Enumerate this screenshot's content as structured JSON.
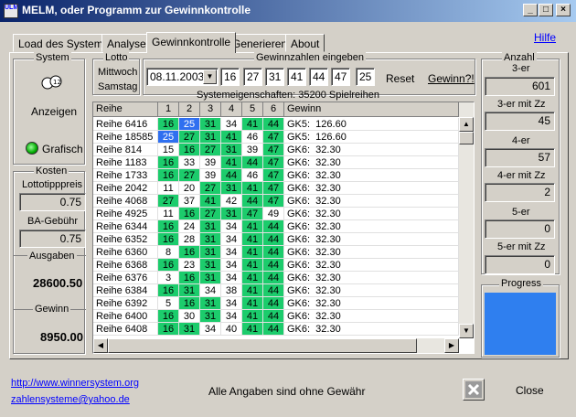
{
  "window": {
    "icon_text": "ULM",
    "title": "MELM, oder Programm zur Gewinnkontrolle",
    "minimize": "_",
    "maximize": "□",
    "close": "×"
  },
  "tabs": [
    "Load des Systems",
    "Analyse",
    "Gewinnkontrolle",
    "Generieren",
    "About"
  ],
  "active_tab": "Gewinnkontrolle",
  "help_link": "Hilfe",
  "system_group": {
    "title": "System",
    "icon": "lotto-balls-icon",
    "anzeigen": "Anzeigen",
    "grafisch": "Grafisch"
  },
  "kosten_group": {
    "title": "Kosten",
    "lottotipppreis_label": "Lottotipppreis",
    "lottotipppreis_value": "0.75",
    "ba_gebuehr_label": "BA-Gebühr",
    "ba_gebuehr_value": "0.75",
    "ausgaben_label": "Ausgaben",
    "ausgaben_value": "28600.50",
    "gewinn_label": "Gewinn",
    "gewinn_value": "8950.00"
  },
  "lotto_group": {
    "title": "Lotto",
    "mittwoch": "Mittwoch",
    "samstag": "Samstag"
  },
  "gewinnzahlen_group": {
    "title": "Gewinnzahlen eingeben",
    "date": "08.11.2003",
    "numbers": [
      "16",
      "27",
      "31",
      "41",
      "44",
      "47"
    ],
    "zusatzzahl": "25",
    "reset": "Reset",
    "gewinn_button": "Gewinn?!"
  },
  "systemeigenschaften": "Systemeigenschaften: 35200 Spielreihen",
  "grid": {
    "headers": [
      "Reihe",
      "1",
      "2",
      "3",
      "4",
      "5",
      "6",
      "Gewinn"
    ],
    "rows": [
      {
        "reihe": "Reihe 6416",
        "nums": [
          "16",
          "25",
          "31",
          "34",
          "41",
          "44"
        ],
        "hl": [
          "g",
          "b",
          "g",
          "",
          "g",
          "g"
        ],
        "gewinn": "GK5:  126.60"
      },
      {
        "reihe": "Reihe 18585",
        "nums": [
          "25",
          "27",
          "31",
          "41",
          "46",
          "47"
        ],
        "hl": [
          "b",
          "g",
          "g",
          "g",
          "",
          "g"
        ],
        "gewinn": "GK5:  126.60"
      },
      {
        "reihe": "Reihe 814",
        "nums": [
          "15",
          "16",
          "27",
          "31",
          "39",
          "47"
        ],
        "hl": [
          "",
          "g",
          "g",
          "g",
          "",
          "g"
        ],
        "gewinn": "GK6:  32.30"
      },
      {
        "reihe": "Reihe 1183",
        "nums": [
          "16",
          "33",
          "39",
          "41",
          "44",
          "47"
        ],
        "hl": [
          "g",
          "",
          "",
          "g",
          "g",
          "g"
        ],
        "gewinn": "GK6:  32.30"
      },
      {
        "reihe": "Reihe 1733",
        "nums": [
          "16",
          "27",
          "39",
          "44",
          "46",
          "47"
        ],
        "hl": [
          "g",
          "g",
          "",
          "g",
          "",
          "g"
        ],
        "gewinn": "GK6:  32.30"
      },
      {
        "reihe": "Reihe 2042",
        "nums": [
          "11",
          "20",
          "27",
          "31",
          "41",
          "47"
        ],
        "hl": [
          "",
          "",
          "g",
          "g",
          "g",
          "g"
        ],
        "gewinn": "GK6:  32.30"
      },
      {
        "reihe": "Reihe 4068",
        "nums": [
          "27",
          "37",
          "41",
          "42",
          "44",
          "47"
        ],
        "hl": [
          "g",
          "",
          "g",
          "",
          "g",
          "g"
        ],
        "gewinn": "GK6:  32.30"
      },
      {
        "reihe": "Reihe 4925",
        "nums": [
          "11",
          "16",
          "27",
          "31",
          "47",
          "49"
        ],
        "hl": [
          "",
          "g",
          "g",
          "g",
          "g",
          ""
        ],
        "gewinn": "GK6:  32.30"
      },
      {
        "reihe": "Reihe 6344",
        "nums": [
          "16",
          "24",
          "31",
          "34",
          "41",
          "44"
        ],
        "hl": [
          "g",
          "",
          "g",
          "",
          "g",
          "g"
        ],
        "gewinn": "GK6:  32.30"
      },
      {
        "reihe": "Reihe 6352",
        "nums": [
          "16",
          "28",
          "31",
          "34",
          "41",
          "44"
        ],
        "hl": [
          "g",
          "",
          "g",
          "",
          "g",
          "g"
        ],
        "gewinn": "GK6:  32.30"
      },
      {
        "reihe": "Reihe 6360",
        "nums": [
          "8",
          "16",
          "31",
          "34",
          "41",
          "44"
        ],
        "hl": [
          "",
          "g",
          "g",
          "",
          "g",
          "g"
        ],
        "gewinn": "GK6:  32.30"
      },
      {
        "reihe": "Reihe 6368",
        "nums": [
          "16",
          "23",
          "31",
          "34",
          "41",
          "44"
        ],
        "hl": [
          "g",
          "",
          "g",
          "",
          "g",
          "g"
        ],
        "gewinn": "GK6:  32.30"
      },
      {
        "reihe": "Reihe 6376",
        "nums": [
          "3",
          "16",
          "31",
          "34",
          "41",
          "44"
        ],
        "hl": [
          "",
          "g",
          "g",
          "",
          "g",
          "g"
        ],
        "gewinn": "GK6:  32.30"
      },
      {
        "reihe": "Reihe 6384",
        "nums": [
          "16",
          "31",
          "34",
          "38",
          "41",
          "44"
        ],
        "hl": [
          "g",
          "g",
          "",
          "",
          "g",
          "g"
        ],
        "gewinn": "GK6:  32.30"
      },
      {
        "reihe": "Reihe 6392",
        "nums": [
          "5",
          "16",
          "31",
          "34",
          "41",
          "44"
        ],
        "hl": [
          "",
          "g",
          "g",
          "",
          "g",
          "g"
        ],
        "gewinn": "GK6:  32.30"
      },
      {
        "reihe": "Reihe 6400",
        "nums": [
          "16",
          "30",
          "31",
          "34",
          "41",
          "44"
        ],
        "hl": [
          "g",
          "",
          "g",
          "",
          "g",
          "g"
        ],
        "gewinn": "GK6:  32.30"
      },
      {
        "reihe": "Reihe 6408",
        "nums": [
          "16",
          "31",
          "34",
          "40",
          "41",
          "44"
        ],
        "hl": [
          "g",
          "g",
          "",
          "",
          "g",
          "g"
        ],
        "gewinn": "GK6:  32.30"
      }
    ]
  },
  "anzahl_group": {
    "title": "Anzahl",
    "items": [
      {
        "label": "3-er",
        "value": "601"
      },
      {
        "label": "3-er mit Zz",
        "value": "45"
      },
      {
        "label": "4-er",
        "value": "57"
      },
      {
        "label": "4-er mit Zz",
        "value": "2"
      },
      {
        "label": "5-er",
        "value": "0"
      },
      {
        "label": "5-er mit Zz",
        "value": "0"
      }
    ],
    "progress_label": "Progress"
  },
  "footer": {
    "url": "http://www.winnersystem.org",
    "email": "zahlensysteme@yahoo.de",
    "disclaimer": "Alle Angaben sind ohne Gewähr",
    "close": "Close"
  },
  "colors": {
    "match_green": "#1ccc6c",
    "zusatz_blue": "#2f6ff0",
    "progress_blue": "#2f7fef"
  }
}
